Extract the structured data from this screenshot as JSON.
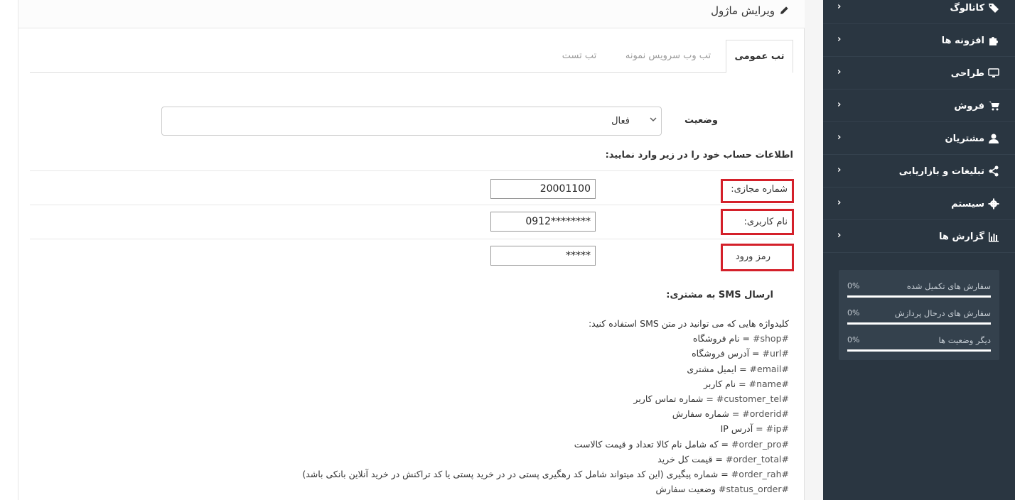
{
  "panel": {
    "title": "ویرایش ماژول"
  },
  "tabs": [
    {
      "label": "تب عمومی",
      "active": true
    },
    {
      "label": "تب وب سرویس نمونه",
      "active": false
    },
    {
      "label": "تب تست",
      "active": false
    }
  ],
  "form": {
    "status_label": "وضعیت",
    "status_value": "فعال",
    "account_heading": "اطلاعات حساب خود را در زیر وارد نمایید:",
    "fields": [
      {
        "label": "شماره مجازی:",
        "value": "20001100"
      },
      {
        "label": "نام کاربری:",
        "value": "0912********"
      },
      {
        "label": "رمز ورود",
        "value": "*****"
      }
    ]
  },
  "sms": {
    "heading_pre": "ارسال",
    "heading_sms": "SMS",
    "heading_post": "به مشتری:",
    "intro": "کلیدواژه هایی که می توانید در متن SMS استفاده کنید:",
    "keywords": [
      {
        "key": "#shop#",
        "desc": "= نام فروشگاه"
      },
      {
        "key": "#url#",
        "desc": "= آدرس فروشگاه"
      },
      {
        "key": "#email#",
        "desc": "= ایمیل مشتری"
      },
      {
        "key": "#name#",
        "desc": "= نام کاربر"
      },
      {
        "key": "#customer_tel#",
        "desc": "= شماره تماس کاربر"
      },
      {
        "key": "#orderid#",
        "desc": "= شماره سفارش"
      },
      {
        "key": "#ip#",
        "desc": "= آدرس IP"
      },
      {
        "key": "#order_pro#",
        "desc": "= که شامل نام کالا تعداد و قیمت کالاست"
      },
      {
        "key": "#order_total#",
        "desc": "= قیمت کل خرید"
      },
      {
        "key": "#order_rah#",
        "desc": "= شماره پیگیری (این کد میتواند شامل کد رهگیری پستی در در خرید پستی یا کد تراکنش در خرید آنلاین بانکی باشد)"
      },
      {
        "key": "#status_order#",
        "desc": "وضعیت سفارش"
      }
    ]
  },
  "sidebar": {
    "items": [
      {
        "label": "کاتالوگ",
        "icon": "tags-icon"
      },
      {
        "label": "افزونه ها",
        "icon": "puzzle-icon"
      },
      {
        "label": "طراحی",
        "icon": "desktop-icon"
      },
      {
        "label": "فروش",
        "icon": "cart-icon"
      },
      {
        "label": "مشتریان",
        "icon": "user-icon"
      },
      {
        "label": "تبلیغات و بازاریابی",
        "icon": "share-icon"
      },
      {
        "label": "سیستم",
        "icon": "gear-icon"
      },
      {
        "label": "گزارش ها",
        "icon": "bar-chart-icon"
      }
    ],
    "chevron": "‹",
    "stats": [
      {
        "label": "سفارش های تکمیل شده",
        "value": "0%",
        "progress": 1.0
      },
      {
        "label": "سفارش های درحال پردازش",
        "value": "0%",
        "progress": 1.0
      },
      {
        "label": "دیگر وضعیت ها",
        "value": "0%",
        "progress": 1.0
      }
    ]
  },
  "colors": {
    "sidebar_bg": "#2a3641",
    "highlight_border": "#d4202a"
  }
}
